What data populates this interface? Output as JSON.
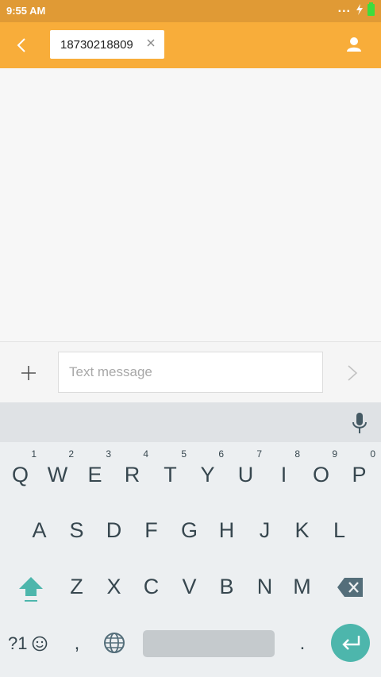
{
  "status_bar": {
    "time": "9:55 AM",
    "overflow": "...",
    "battery_color": "#3ddc3d",
    "bolt": "charging-bolt-icon"
  },
  "toolbar": {
    "background": "#f8ad3a",
    "recipient_number": "18730218809",
    "back_icon": "chevron-left-icon",
    "remove_icon": "close-icon",
    "contact_icon": "person-icon"
  },
  "composer": {
    "placeholder": "Text message",
    "add_icon": "plus-icon",
    "send_icon": "chevron-right-icon"
  },
  "keyboard": {
    "row1": [
      {
        "label": "Q",
        "hint": "1"
      },
      {
        "label": "W",
        "hint": "2"
      },
      {
        "label": "E",
        "hint": "3"
      },
      {
        "label": "R",
        "hint": "4"
      },
      {
        "label": "T",
        "hint": "5"
      },
      {
        "label": "Y",
        "hint": "6"
      },
      {
        "label": "U",
        "hint": "7"
      },
      {
        "label": "I",
        "hint": "8"
      },
      {
        "label": "O",
        "hint": "9"
      },
      {
        "label": "P",
        "hint": "0"
      }
    ],
    "row2": [
      "A",
      "S",
      "D",
      "F",
      "G",
      "H",
      "J",
      "K",
      "L"
    ],
    "row3": [
      "Z",
      "X",
      "C",
      "V",
      "B",
      "N",
      "M"
    ],
    "symbols_label": "?1",
    "comma": ",",
    "period": ".",
    "accent_color": "#4db6ac"
  }
}
